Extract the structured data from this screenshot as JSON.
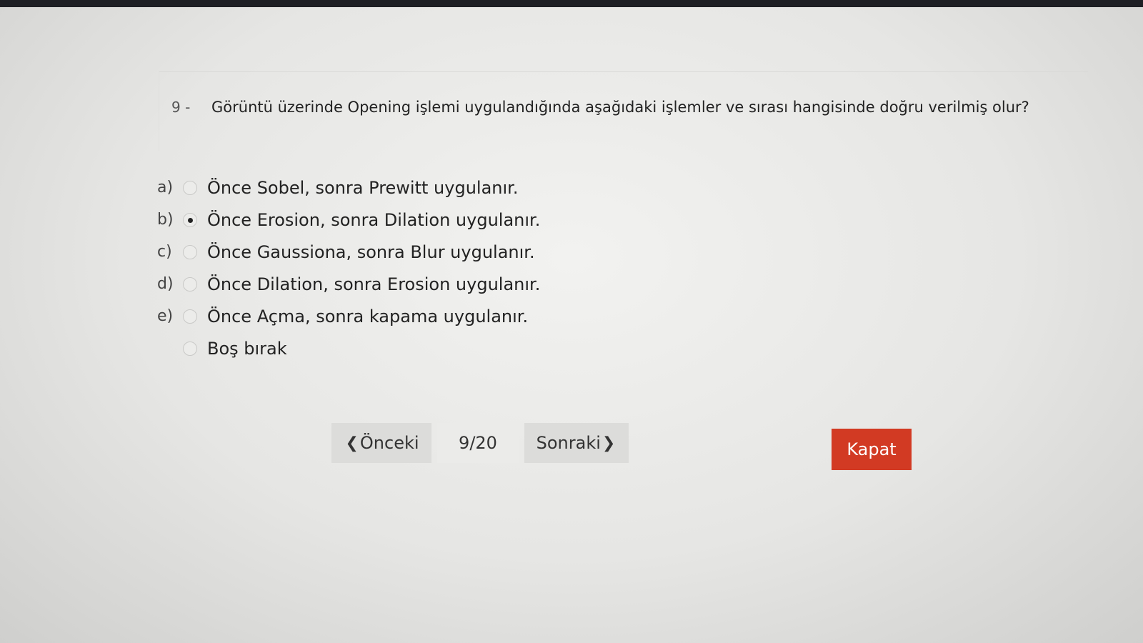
{
  "question": {
    "number": "9 -",
    "text": "Görüntü üzerinde Opening işlemi uygulandığında aşağıdaki işlemler ve sırası hangisinde doğru verilmiş olur?"
  },
  "options": [
    {
      "letter": "a)",
      "label": "Önce Sobel, sonra Prewitt uygulanır.",
      "selected": false
    },
    {
      "letter": "b)",
      "label": "Önce Erosion, sonra Dilation uygulanır.",
      "selected": true
    },
    {
      "letter": "c)",
      "label": "Önce Gaussiona, sonra Blur uygulanır.",
      "selected": false
    },
    {
      "letter": "d)",
      "label": "Önce Dilation, sonra Erosion uygulanır.",
      "selected": false
    },
    {
      "letter": "e)",
      "label": "Önce Açma, sonra kapama uygulanır.",
      "selected": false
    },
    {
      "letter": "",
      "label": "Boş bırak",
      "selected": false
    }
  ],
  "navigation": {
    "prev_label": "Önceki",
    "counter": "9/20",
    "next_label": "Sonraki",
    "prev_icon": "chevron-left-icon",
    "next_icon": "chevron-right-icon"
  },
  "close_label": "Kapat",
  "colors": {
    "close_button": "#d23a23",
    "nav_button": "#dcdcda"
  }
}
